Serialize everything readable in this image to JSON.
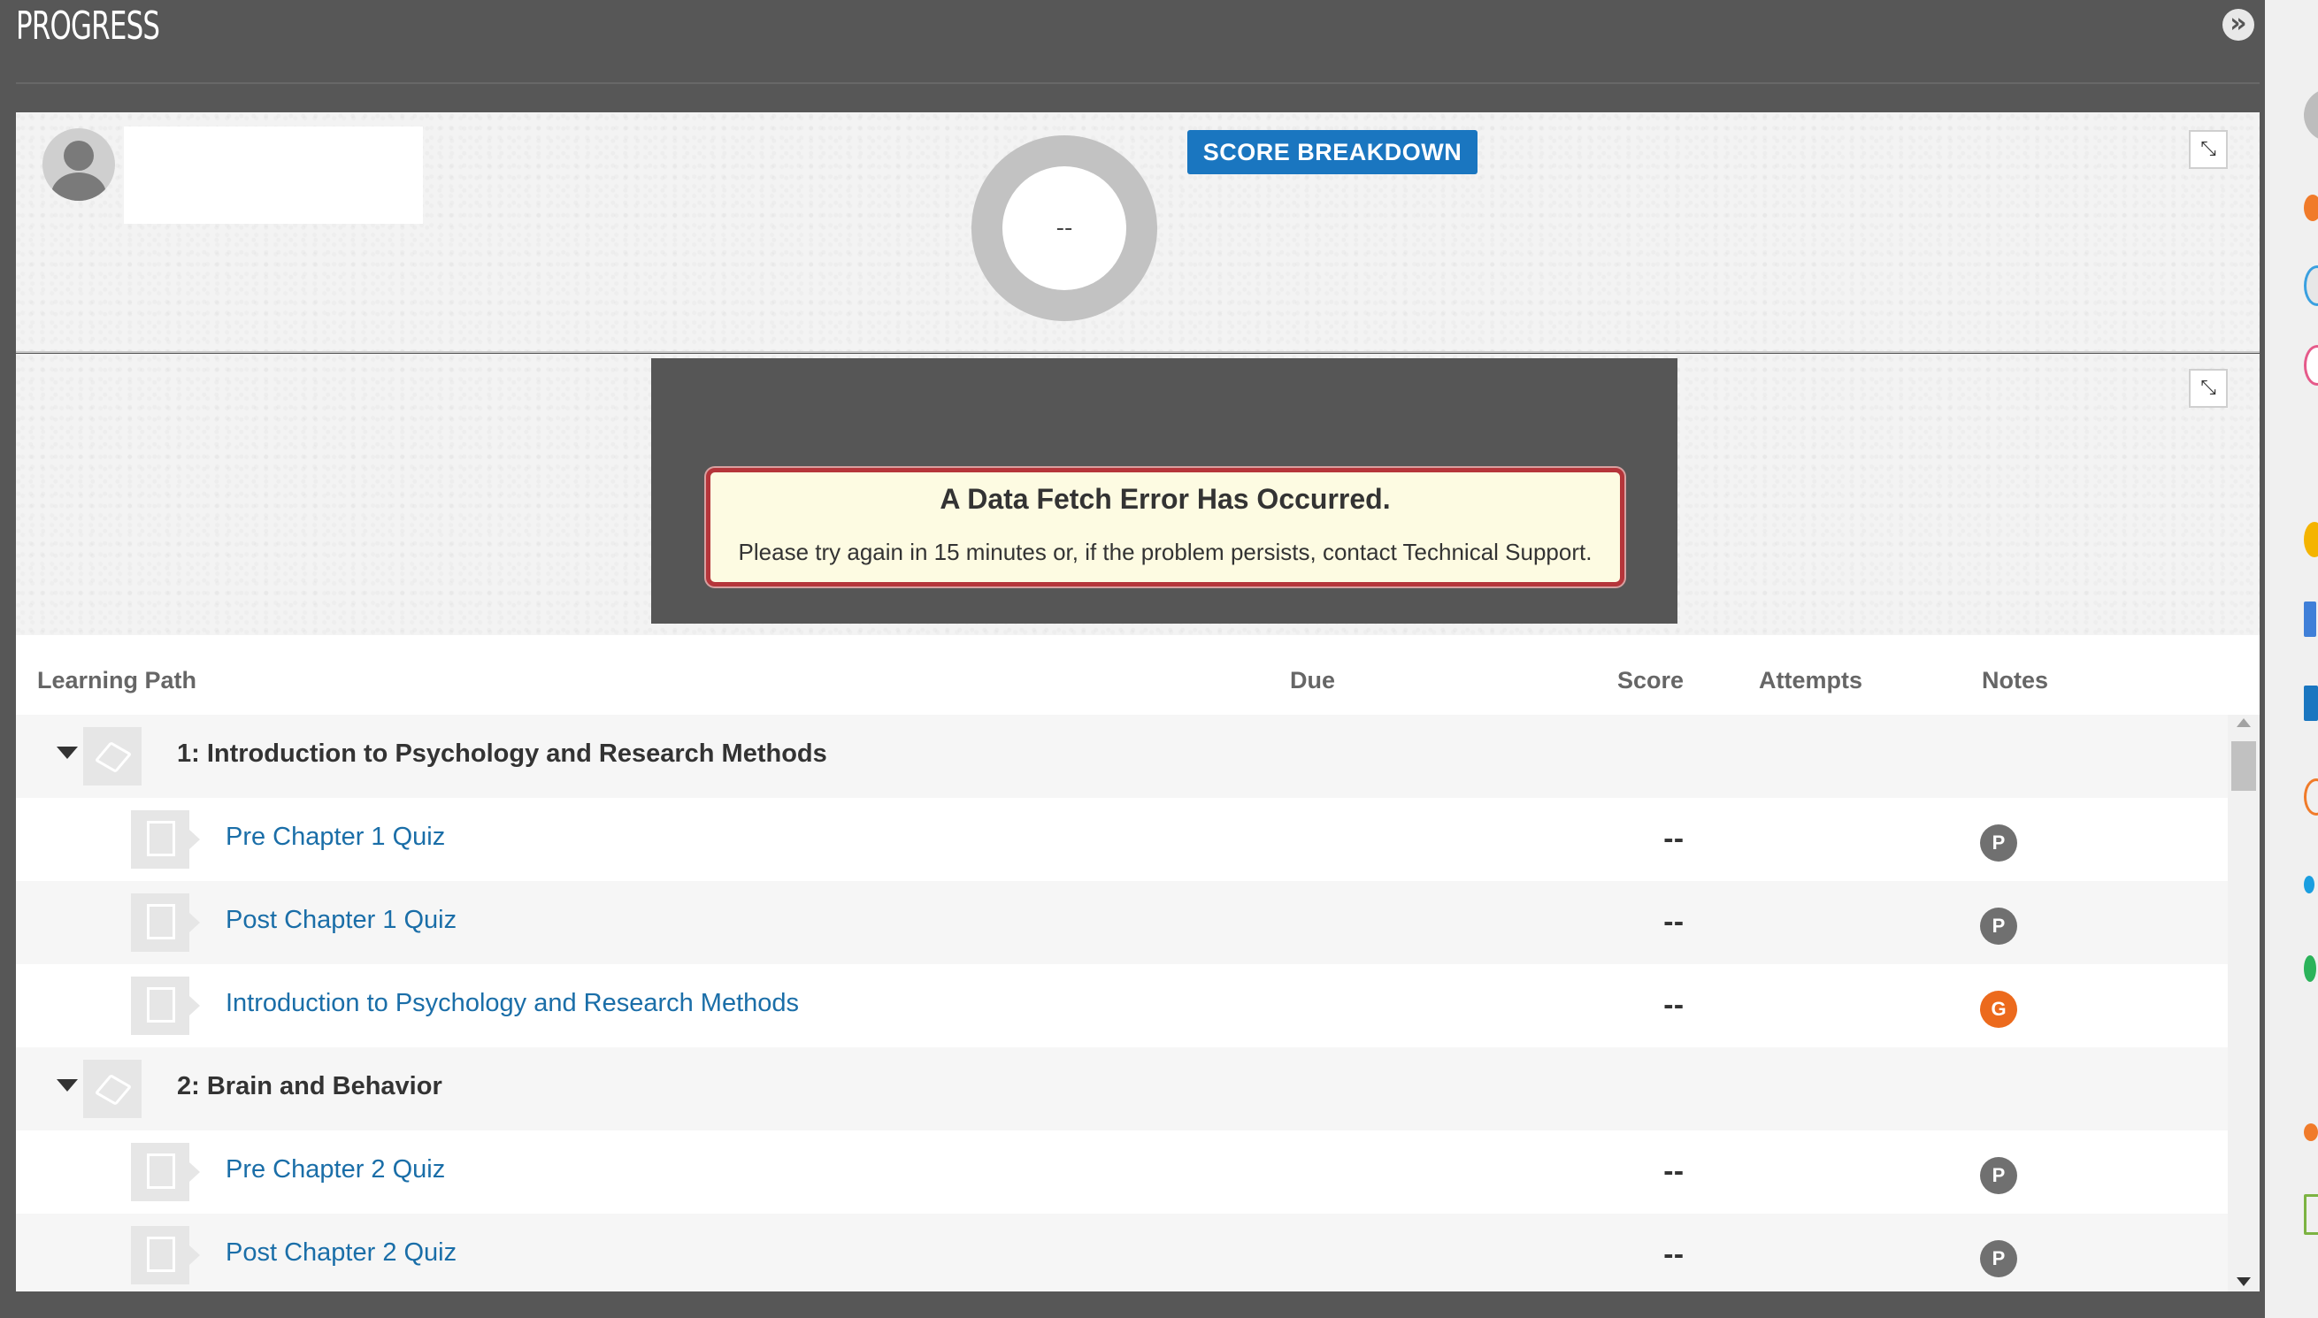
{
  "header": {
    "title": "PROGRESS"
  },
  "summary": {
    "score_display": "--",
    "score_breakdown_label": "SCORE BREAKDOWN"
  },
  "error": {
    "title": "A Data Fetch Error Has Occurred.",
    "message": "Please try again in 15 minutes or, if the problem persists, contact Technical Support."
  },
  "table": {
    "columns": {
      "learning_path": "Learning Path",
      "due": "Due",
      "score": "Score",
      "attempts": "Attempts",
      "notes": "Notes"
    },
    "rows": [
      {
        "kind": "chapter",
        "title": "1: Introduction to Psychology and Research Methods"
      },
      {
        "kind": "item",
        "title": "Pre Chapter 1 Quiz",
        "score": "--",
        "note": "P"
      },
      {
        "kind": "item",
        "title": "Post Chapter 1 Quiz",
        "score": "--",
        "note": "P"
      },
      {
        "kind": "item",
        "title": "Introduction to Psychology and Research Methods",
        "score": "--",
        "note": "G"
      },
      {
        "kind": "chapter",
        "title": "2: Brain and Behavior"
      },
      {
        "kind": "item",
        "title": "Pre Chapter 2 Quiz",
        "score": "--",
        "note": "P"
      },
      {
        "kind": "item",
        "title": "Post Chapter 2 Quiz",
        "score": "--",
        "note": "P"
      }
    ]
  },
  "colors": {
    "accent": "#1a76c0",
    "link": "#1a6ea8",
    "note_p": "#707070",
    "note_g": "#ec6a1d",
    "error_border": "#b5353a"
  }
}
